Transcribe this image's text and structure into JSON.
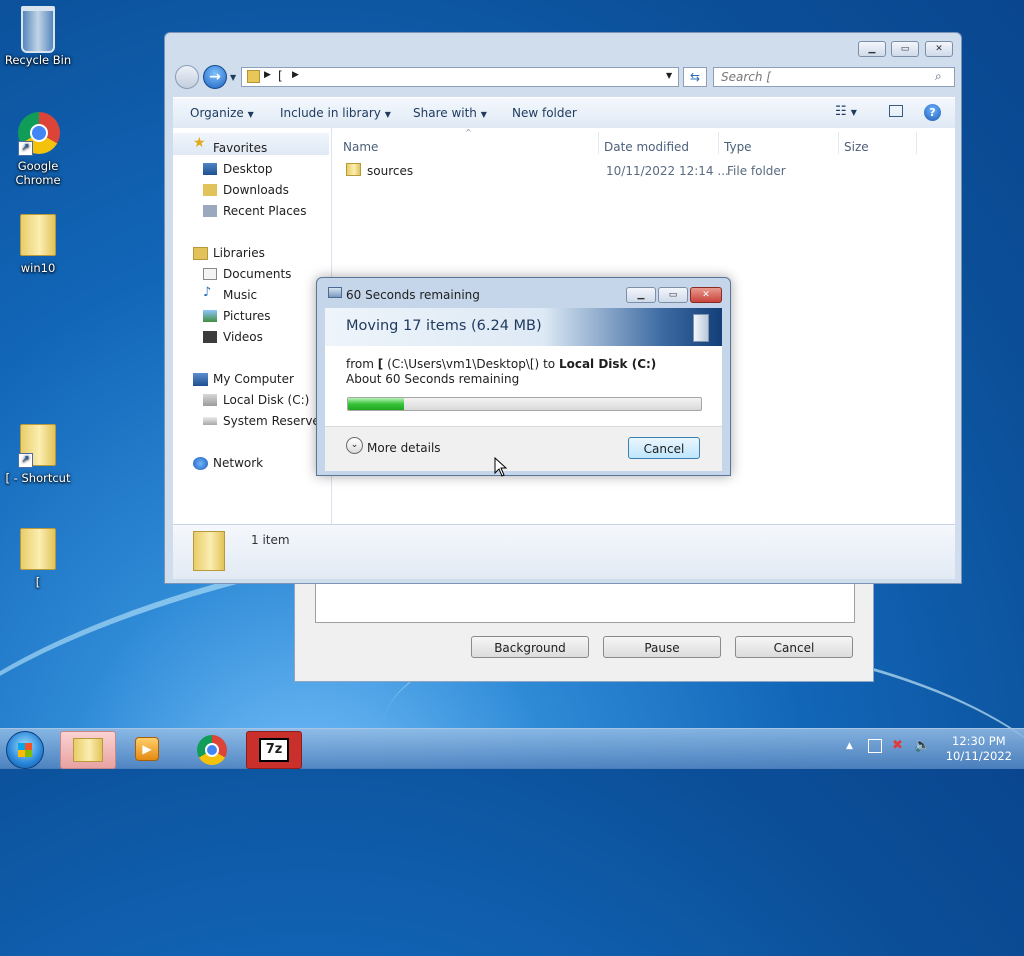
{
  "desktop": {
    "icons": [
      {
        "label": "Recycle Bin"
      },
      {
        "label": "Google Chrome"
      },
      {
        "label": "win10"
      },
      {
        "label": "[ - Shortcut"
      },
      {
        "label": "["
      }
    ]
  },
  "background_dialog": {
    "buttons": {
      "background": "Background",
      "pause": "Pause",
      "cancel": "Cancel"
    }
  },
  "explorer": {
    "address": "[",
    "search_placeholder": "Search [",
    "commands": {
      "organize": "Organize",
      "include_in_library": "Include in library",
      "share_with": "Share with",
      "new_folder": "New folder"
    },
    "nav": {
      "favorites": {
        "label": "Favorites",
        "items": [
          "Desktop",
          "Downloads",
          "Recent Places"
        ]
      },
      "libraries": {
        "label": "Libraries",
        "items": [
          "Documents",
          "Music",
          "Pictures",
          "Videos"
        ]
      },
      "computer": {
        "label": "My Computer",
        "items": [
          "Local Disk (C:)",
          "System Reserved ("
        ]
      },
      "network": {
        "label": "Network"
      }
    },
    "columns": {
      "name": "Name",
      "date_modified": "Date modified",
      "type": "Type",
      "size": "Size"
    },
    "files": [
      {
        "name": "sources",
        "date_modified": "10/11/2022 12:14 ...",
        "type": "File folder",
        "size": ""
      }
    ],
    "status": "1 item"
  },
  "progress_dialog": {
    "title": "60 Seconds remaining",
    "heading": "Moving 17 items (6.24 MB)",
    "from_label": "from",
    "from_name": "[",
    "from_path": "(C:\\Users\\vm1\\Desktop\\[)",
    "to_label": "to",
    "to_name": "Local Disk (C:)",
    "remaining": "About 60 Seconds remaining",
    "progress_fraction": 0.16,
    "more_details": "More details",
    "cancel": "Cancel"
  },
  "taskbar": {
    "time": "12:30 PM",
    "date": "10/11/2022",
    "apps": [
      "windows-explorer",
      "media-player",
      "google-chrome",
      "7-zip"
    ]
  },
  "colors": {
    "accent": "#1266b8",
    "progress_green": "#39c339",
    "close_red": "#c8453c"
  }
}
